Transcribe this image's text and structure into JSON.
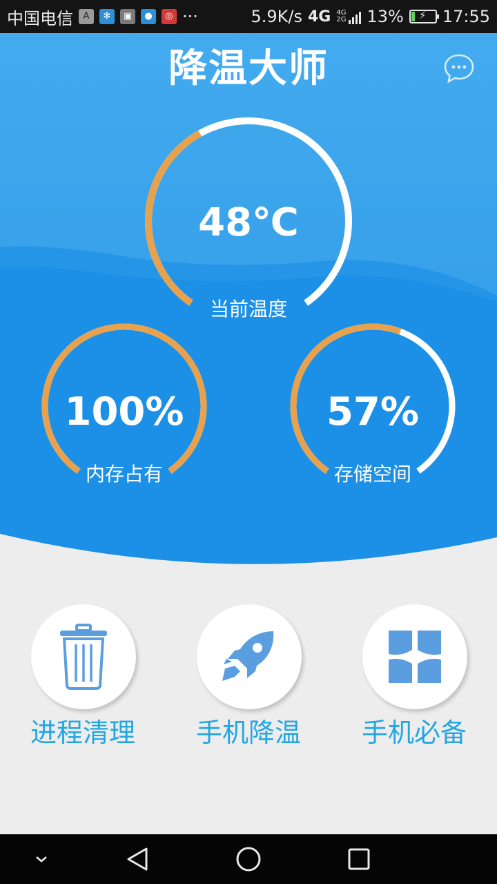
{
  "status_bar": {
    "carrier": "中国电信",
    "notification_icons": [
      "a-icon",
      "snowflake-icon",
      "image-icon",
      "chat-bubble-icon",
      "netease-music-icon"
    ],
    "more": "···",
    "speed": "5.9K/s",
    "network_main": "4G",
    "network_top": "4G",
    "network_bottom": "2G",
    "battery": "13%",
    "time": "17:55"
  },
  "header": {
    "title": "降温大师"
  },
  "gauges": {
    "temperature": {
      "value": "48℃",
      "label": "当前温度",
      "fraction": 0.4
    },
    "memory": {
      "value": "100%",
      "label": "内存占有",
      "fraction": 1.0
    },
    "storage": {
      "value": "57%",
      "label": "存储空间",
      "fraction": 0.57
    }
  },
  "actions": [
    {
      "label": "进程清理",
      "icon": "trash-icon"
    },
    {
      "label": "手机降温",
      "icon": "rocket-icon"
    },
    {
      "label": "手机必备",
      "icon": "app-grid-icon"
    }
  ],
  "colors": {
    "bg_top": "#3aa6ea",
    "bg_bottom": "#1a8fe6",
    "arc_track": "#ffffff",
    "arc_fill": "#e8a24e",
    "action_text": "#23a6e2",
    "icon_blue": "#5a9ee0"
  }
}
